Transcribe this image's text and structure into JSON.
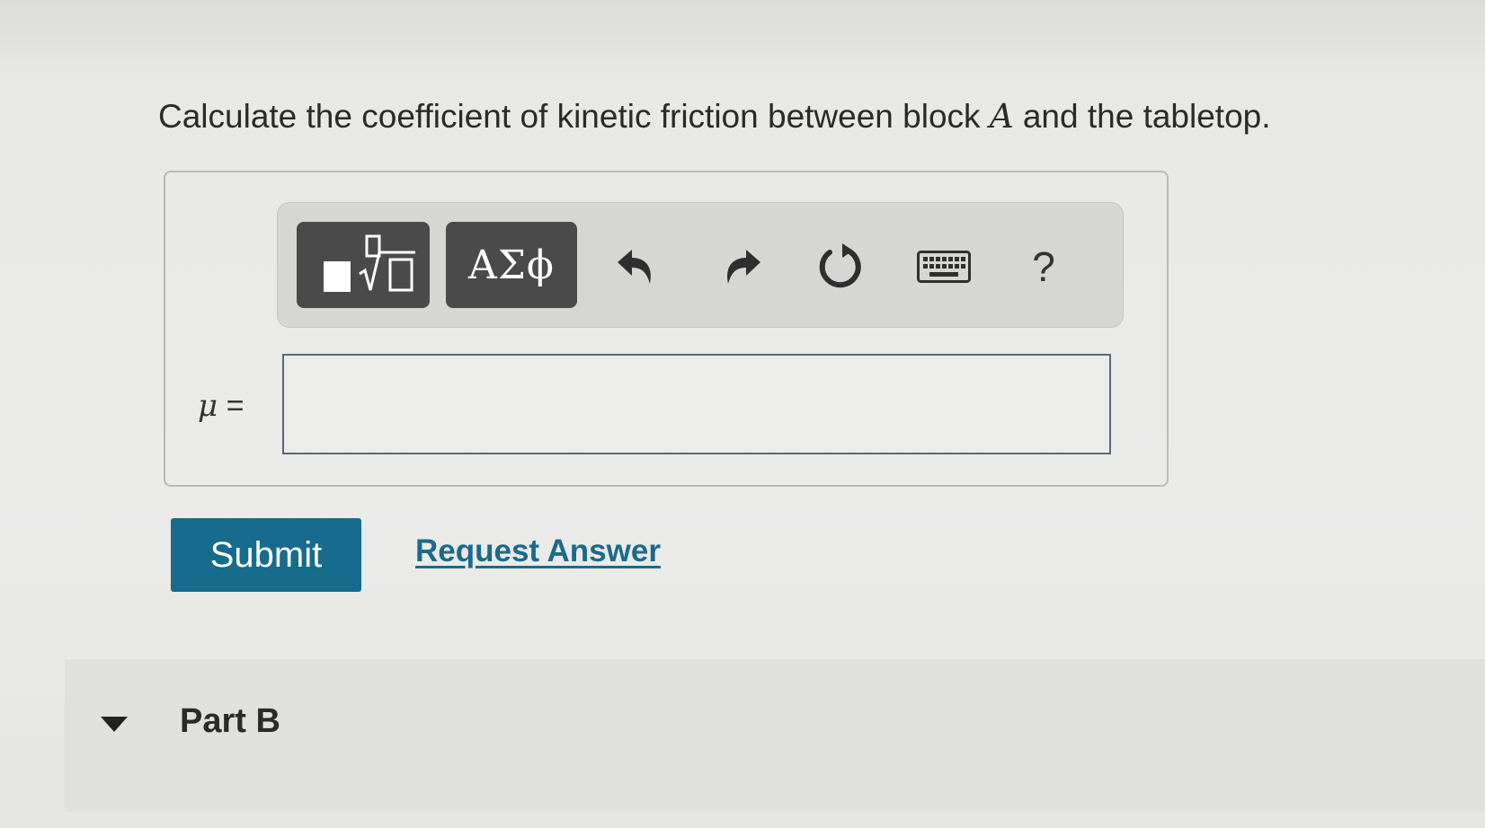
{
  "question": {
    "text_before": "Calculate the coefficient of kinetic friction between block ",
    "variable": "A",
    "text_after": " and the tabletop."
  },
  "toolbar": {
    "templates_icon": "fraction-root-template-icon",
    "symbols_label": "ΑΣϕ",
    "undo_icon": "undo-icon",
    "redo_icon": "redo-icon",
    "reset_icon": "reset-icon",
    "keyboard_icon": "keyboard-icon",
    "help_label": "?"
  },
  "answer": {
    "variable": "μ",
    "equals": "=",
    "value": ""
  },
  "actions": {
    "submit_label": "Submit",
    "request_label": "Request Answer",
    "submit_color": "#176b8c",
    "link_color": "#1b6a8a"
  },
  "part_b": {
    "label": "Part B",
    "expanded": true
  }
}
